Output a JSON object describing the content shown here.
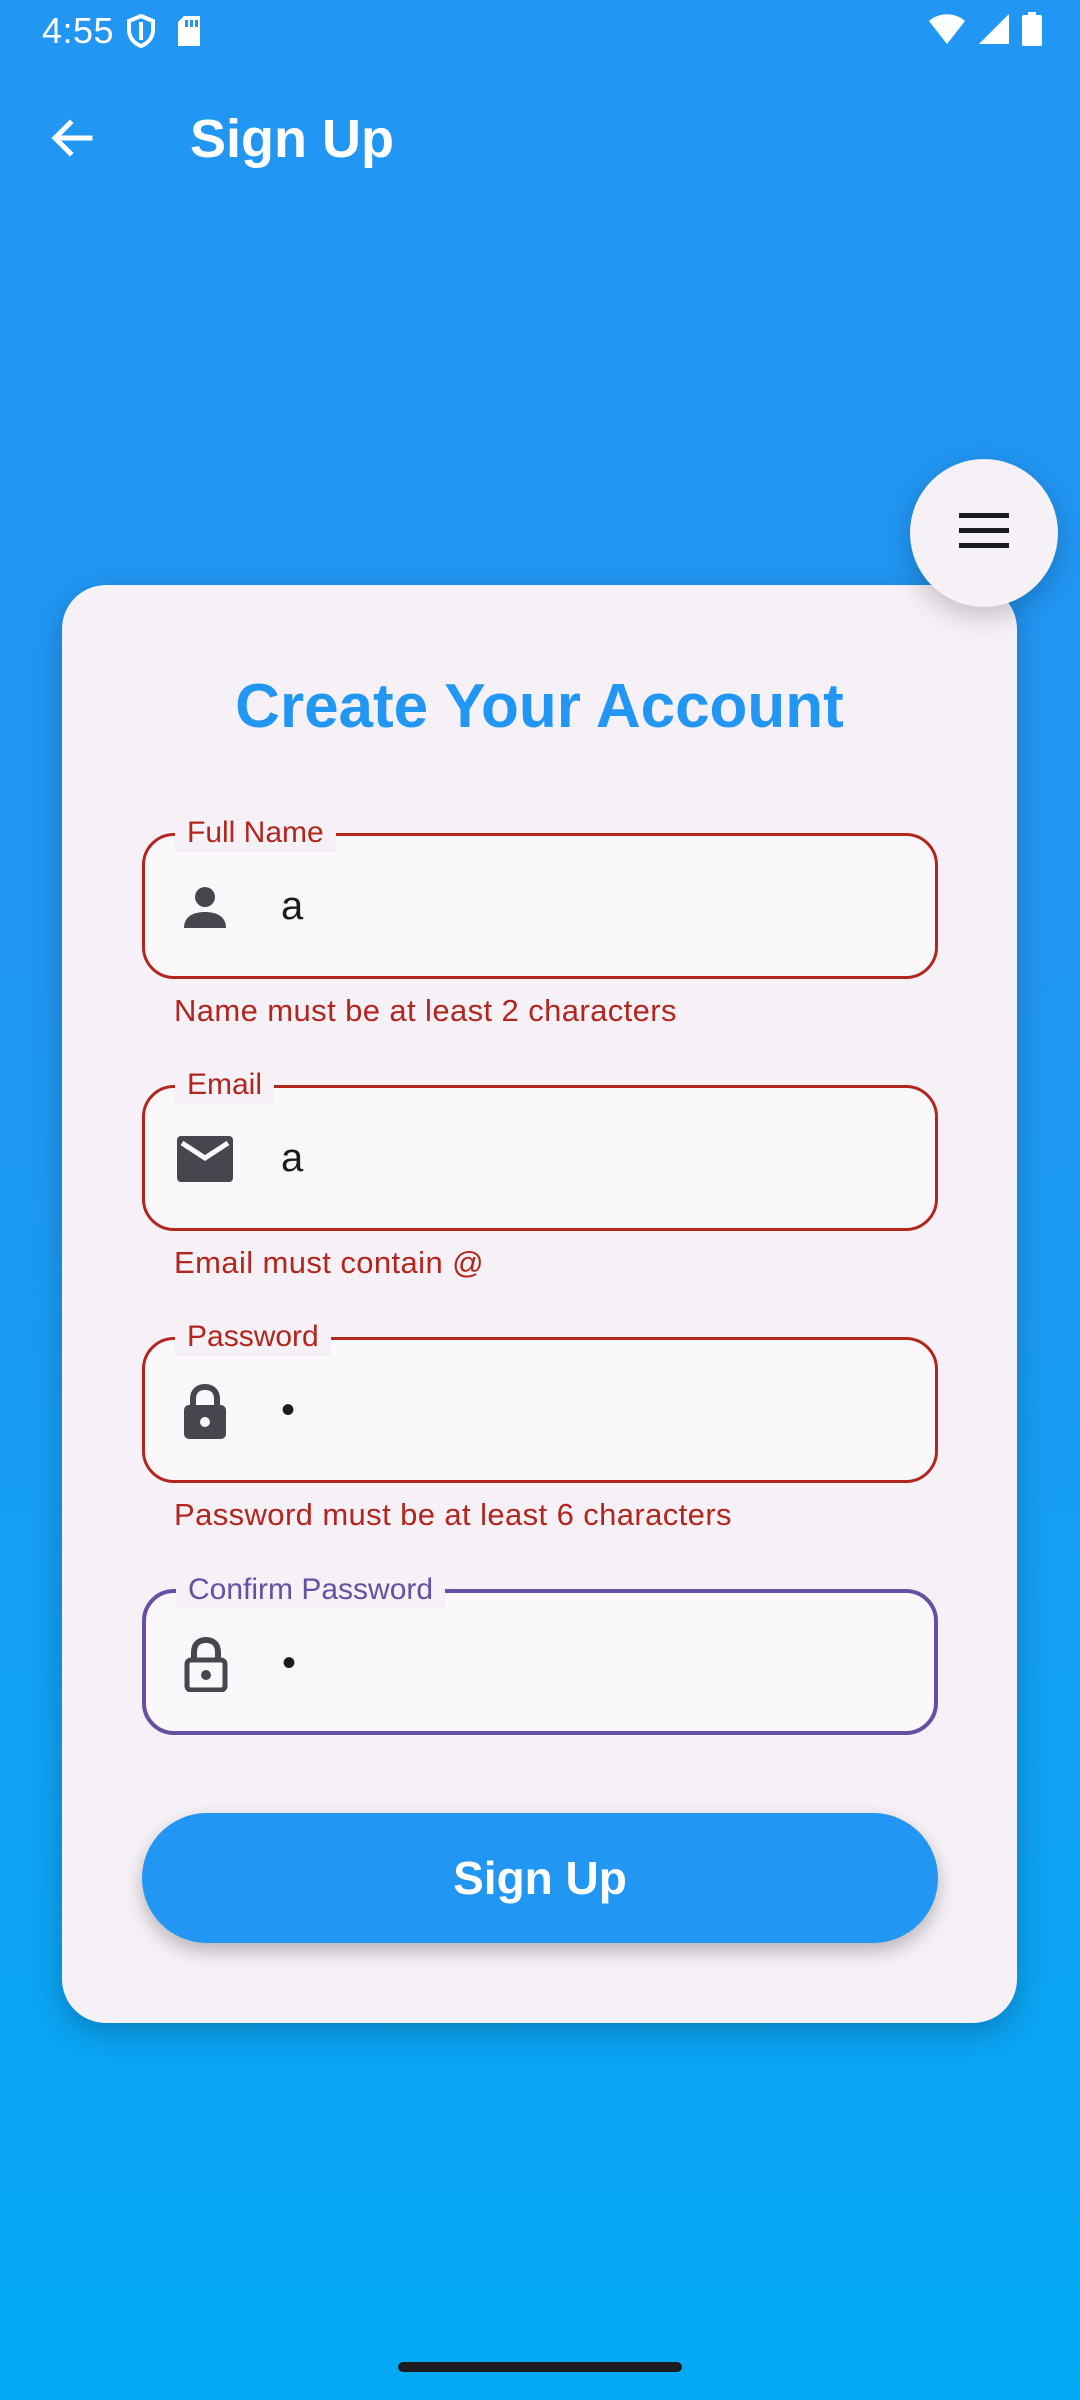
{
  "status_bar": {
    "time": "4:55",
    "left_icons": [
      "shield-icon",
      "sd-card-icon"
    ],
    "right_icons": [
      "wifi-icon",
      "signal-icon",
      "battery-icon"
    ]
  },
  "app_bar": {
    "title": "Sign Up",
    "back_icon": "arrow-back-icon"
  },
  "menu_button": {
    "icon": "menu-icon"
  },
  "form": {
    "title": "Create Your Account",
    "fields": [
      {
        "label": "Full Name",
        "value": "a",
        "icon": "person-icon",
        "error": "Name must be at least 2 characters"
      },
      {
        "label": "Email",
        "value": "a",
        "icon": "mail-icon",
        "error": "Email must contain @"
      },
      {
        "label": "Password",
        "value": "•",
        "icon": "lock-icon",
        "error": "Password must be at least 6 characters"
      },
      {
        "label": "Confirm Password",
        "value": "•",
        "icon": "lock-outline-icon",
        "error": ""
      }
    ],
    "submit_label": "Sign Up"
  },
  "colors": {
    "primary": "#2196f3",
    "error": "#b3261e",
    "focus": "#6750a4",
    "card": "#f6f0f7"
  }
}
